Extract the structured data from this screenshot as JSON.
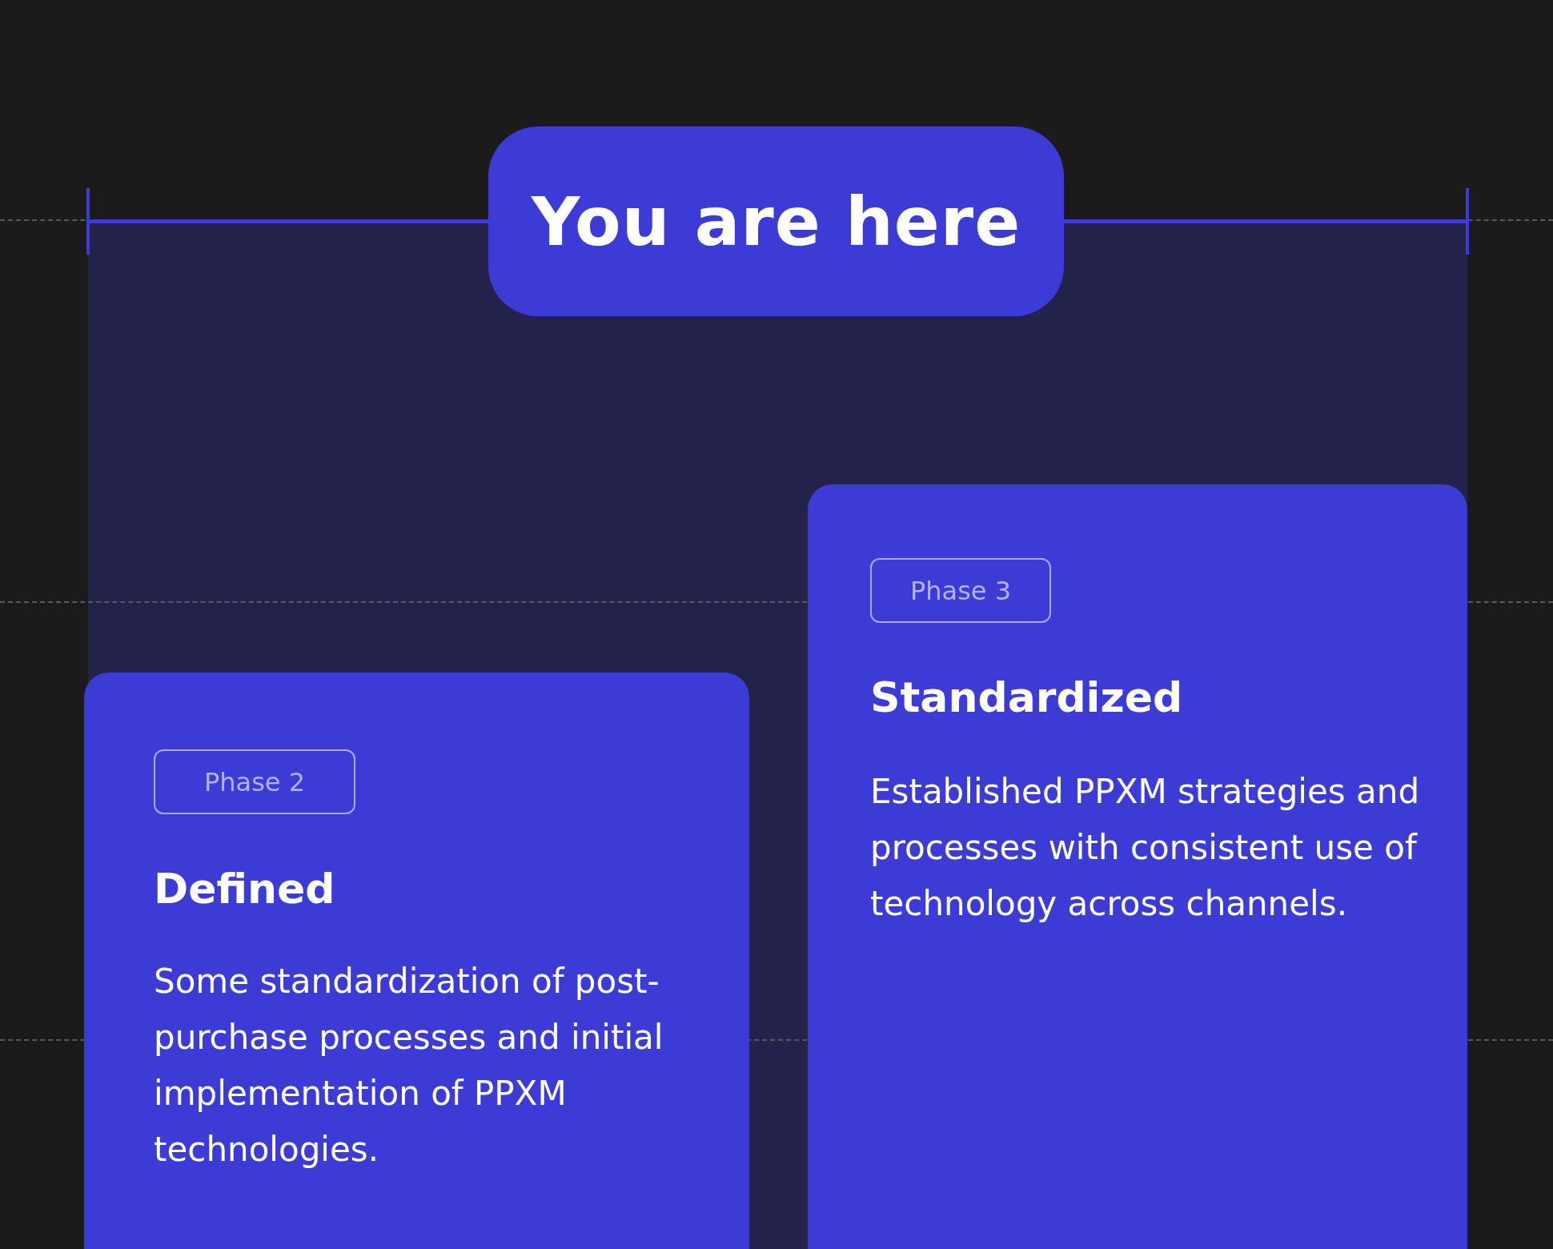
{
  "marker": {
    "label": "You are here"
  },
  "phases": [
    {
      "badge": "Phase 2",
      "title": "Defined",
      "description": "Some standardization of post-purchase processes and initial implementation of PPXM technologies."
    },
    {
      "badge": "Phase 3",
      "title": "Standardized",
      "description": "Established PPXM strategies and processes with consistent use of technology across channels."
    }
  ]
}
